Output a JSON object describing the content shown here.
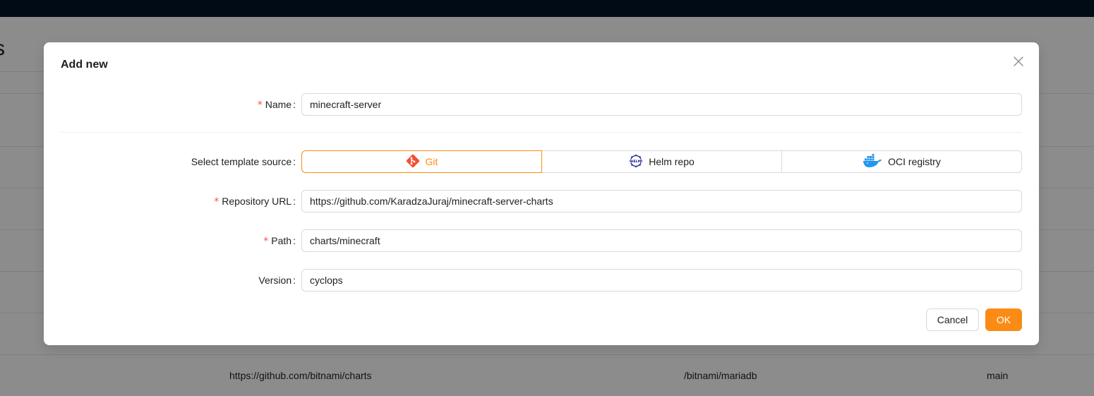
{
  "background": {
    "heading_fragment": "s",
    "row": {
      "repository": "https://github.com/bitnami/charts",
      "path": "/bitnami/mariadb",
      "version": "main"
    }
  },
  "modal": {
    "title": "Add new",
    "close_icon": "close-icon",
    "fields": {
      "name": {
        "label": "Name",
        "required": true,
        "value": "minecraft-server"
      },
      "template_source": {
        "label": "Select template source",
        "options": [
          {
            "label": "Git",
            "icon": "git-icon",
            "selected": true
          },
          {
            "label": "Helm repo",
            "icon": "helm-icon",
            "selected": false
          },
          {
            "label": "OCI registry",
            "icon": "docker-icon",
            "selected": false
          }
        ]
      },
      "repository_url": {
        "label": "Repository URL",
        "required": true,
        "value": "https://github.com/KaradzaJuraj/minecraft-server-charts"
      },
      "path": {
        "label": "Path",
        "required": true,
        "value": "charts/minecraft"
      },
      "version": {
        "label": "Version",
        "required": false,
        "value": "cyclops"
      }
    },
    "buttons": {
      "cancel": "Cancel",
      "ok": "OK"
    }
  },
  "colors": {
    "accent": "#fa8c16",
    "required_mark": "#ff4d4f",
    "git_brand": "#f05133",
    "helm_brand": "#0f1689",
    "docker_brand": "#2496ed",
    "topbar": "#001529"
  }
}
